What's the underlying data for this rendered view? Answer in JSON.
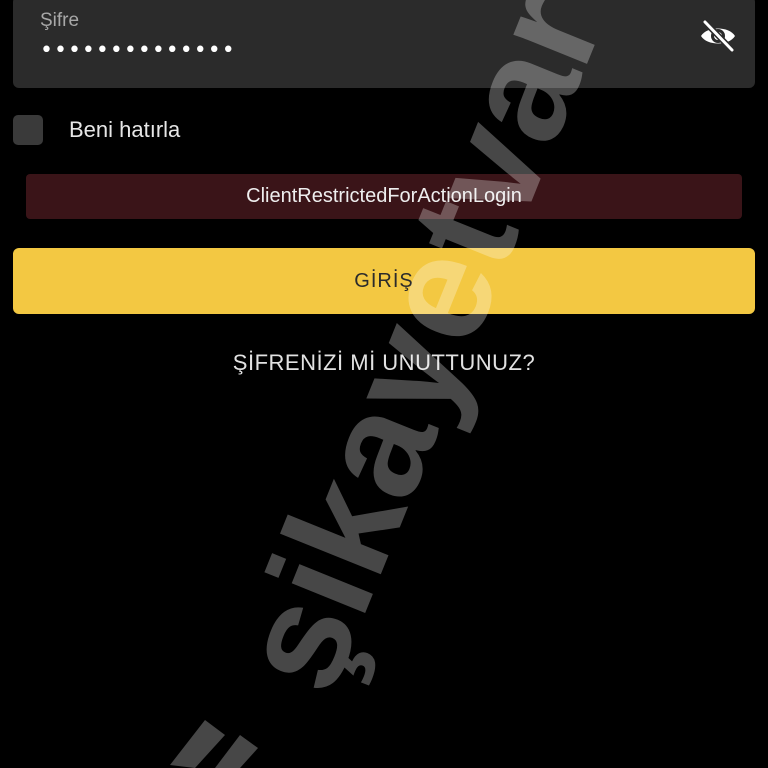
{
  "password": {
    "label": "Şifre",
    "value": "••••••••••••••",
    "visibility_icon": "eye-slash-icon"
  },
  "remember": {
    "label": "Beni hatırla",
    "checked": false
  },
  "error": {
    "message": "ClientRestrictedForActionLogin"
  },
  "login": {
    "label": "GİRİŞ"
  },
  "forgot": {
    "label": "ŞİFRENİZİ Mİ UNUTTUNUZ?"
  },
  "watermark": {
    "text": "şikayetvar"
  },
  "colors": {
    "background": "#000000",
    "field": "#2b2b2b",
    "error_bg": "#3a1418",
    "accent": "#f3c842"
  }
}
